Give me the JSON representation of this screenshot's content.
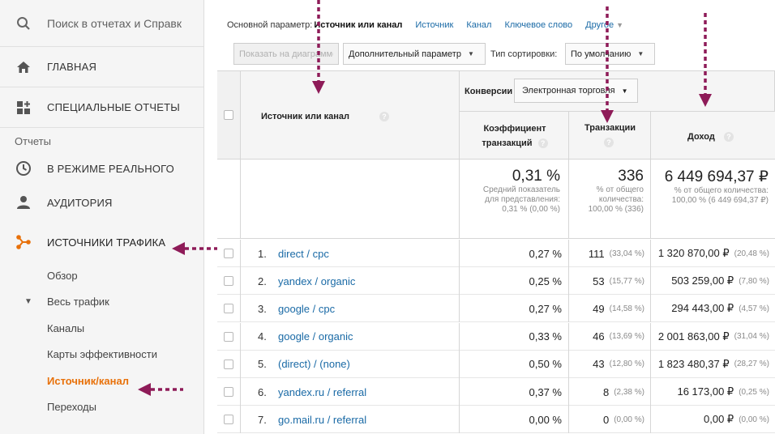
{
  "sidebar": {
    "search_placeholder": "Поиск в отчетах и Справк",
    "home": "ГЛАВНАЯ",
    "custom_reports": "СПЕЦИАЛЬНЫЕ ОТЧЕТЫ",
    "reports_section": "Отчеты",
    "realtime": "В РЕЖИМЕ РЕАЛЬНОГО",
    "audience": "АУДИТОРИЯ",
    "traffic_sources": "ИСТОЧНИКИ ТРАФИКА",
    "overview": "Обзор",
    "all_traffic": "Весь трафик",
    "channels": "Каналы",
    "treemaps": "Карты эффективности",
    "source_medium": "Источник/канал",
    "referrals": "Переходы"
  },
  "toolbar": {
    "primary_dimension_label": "Основной параметр:",
    "primary_dimension_current": "Источник или канал",
    "dim_links": [
      "Источник",
      "Канал",
      "Ключевое слово",
      "Другое"
    ],
    "plot_rows": "Показать на диаграмме",
    "secondary_dimension": "Дополнительный параметр",
    "sort_type_label": "Тип сортировки:",
    "sort_type_value": "По умолчанию"
  },
  "table": {
    "dimension_header": "Источник или канал",
    "conversions_label": "Конверсии",
    "conversions_select": "Электронная торговля",
    "col_conv_rate": "Коэффициент транзакций",
    "col_transactions": "Транзакции",
    "col_revenue": "Доход",
    "totals": {
      "conv_rate": "0,31 %",
      "conv_rate_note1": "Средний показатель",
      "conv_rate_note2": "для представления:",
      "conv_rate_note3": "0,31 % (0,00 %)",
      "transactions": "336",
      "transactions_note1": "% от общего",
      "transactions_note2": "количества:",
      "transactions_note3": "100,00 % (336)",
      "revenue": "6 449 694,37 ₽",
      "revenue_note1": "% от общего количества:",
      "revenue_note2": "100,00 % (6 449 694,37 ₽)"
    },
    "rows": [
      {
        "n": "1.",
        "source": "direct / cpc",
        "rate": "0,27 %",
        "tx": "111",
        "tx_pct": "(33,04 %)",
        "rev": "1 320 870,00 ₽",
        "rev_pct": "(20,48 %)"
      },
      {
        "n": "2.",
        "source": "yandex / organic",
        "rate": "0,25 %",
        "tx": "53",
        "tx_pct": "(15,77 %)",
        "rev": "503 259,00 ₽",
        "rev_pct": "(7,80 %)"
      },
      {
        "n": "3.",
        "source": "google / cpc",
        "rate": "0,27 %",
        "tx": "49",
        "tx_pct": "(14,58 %)",
        "rev": "294 443,00 ₽",
        "rev_pct": "(4,57 %)"
      },
      {
        "n": "4.",
        "source": "google / organic",
        "rate": "0,33 %",
        "tx": "46",
        "tx_pct": "(13,69 %)",
        "rev": "2 001 863,00 ₽",
        "rev_pct": "(31,04 %)"
      },
      {
        "n": "5.",
        "source": "(direct) / (none)",
        "rate": "0,50 %",
        "tx": "43",
        "tx_pct": "(12,80 %)",
        "rev": "1 823 480,37 ₽",
        "rev_pct": "(28,27 %)"
      },
      {
        "n": "6.",
        "source": "yandex.ru / referral",
        "rate": "0,37 %",
        "tx": "8",
        "tx_pct": "(2,38 %)",
        "rev": "16 173,00 ₽",
        "rev_pct": "(0,25 %)"
      },
      {
        "n": "7.",
        "source": "go.mail.ru / referral",
        "rate": "0,00 %",
        "tx": "0",
        "tx_pct": "(0,00 %)",
        "rev": "0,00 ₽",
        "rev_pct": "(0,00 %)"
      }
    ]
  },
  "colors": {
    "accent_orange": "#e8710a",
    "link_blue": "#1a6aa6",
    "annotation": "#8e1b58"
  }
}
